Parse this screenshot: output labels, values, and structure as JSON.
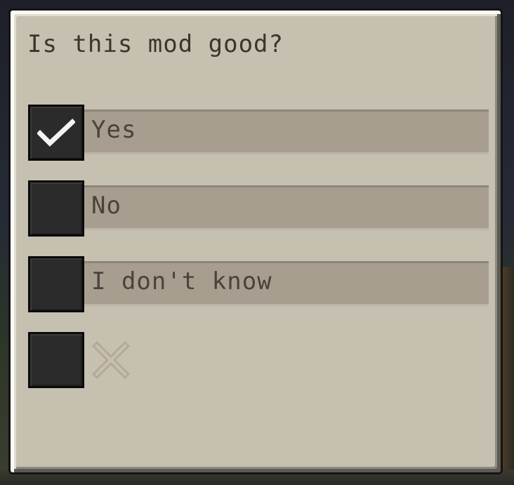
{
  "question": {
    "text": "Is this mod good?"
  },
  "options": [
    {
      "label": "Yes",
      "checked": true
    },
    {
      "label": "No",
      "checked": false
    },
    {
      "label": "I don't know",
      "checked": false
    }
  ],
  "clear_option": {
    "checked": false,
    "icon": "x-icon"
  },
  "colors": {
    "panel": "#c6c0b1",
    "label_bar": "#a79e90",
    "checkbox": "#2b2b2b",
    "text": "#3d342b",
    "x_icon": "#b3aa98"
  }
}
